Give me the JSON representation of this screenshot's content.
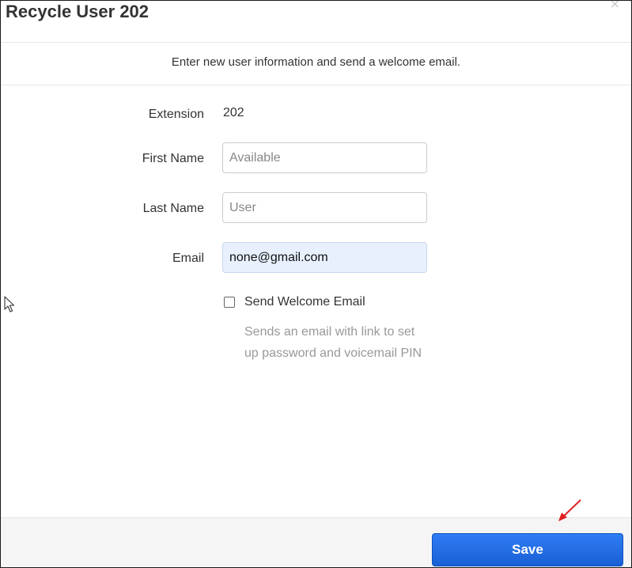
{
  "dialog": {
    "title": "Recycle User 202",
    "close_symbol": "×",
    "intro": "Enter new user information and send a welcome email."
  },
  "form": {
    "extension": {
      "label": "Extension",
      "value": "202"
    },
    "first_name": {
      "label": "First Name",
      "placeholder": "Available",
      "value": ""
    },
    "last_name": {
      "label": "Last Name",
      "placeholder": "User",
      "value": ""
    },
    "email": {
      "label": "Email",
      "value": "none@gmail.com"
    },
    "send_welcome": {
      "label": "Send Welcome Email",
      "checked": false,
      "hint_line1": "Sends an email with link to set",
      "hint_line2": "up password and voicemail PIN"
    }
  },
  "footer": {
    "save_label": "Save"
  },
  "icons": {
    "close": "close-icon",
    "annotation_arrow": "red-arrow-icon",
    "cursor": "mouse-pointer-icon"
  },
  "colors": {
    "save_button": "#1f6fe8",
    "autofill_bg": "#e8f0fe",
    "annotation_arrow": "#e02020"
  }
}
